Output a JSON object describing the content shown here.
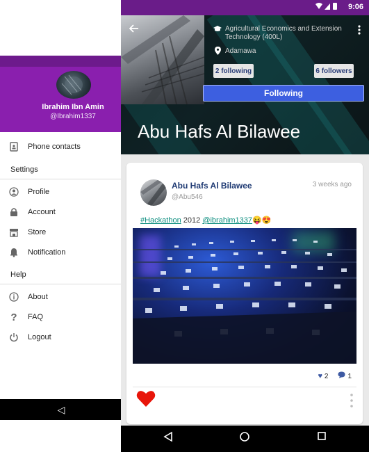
{
  "drawer": {
    "user_name": "Ibrahim Ibn Amin",
    "user_handle": "@Ibrahim1337",
    "items": [
      {
        "label": "Phone contacts",
        "icon": "contacts-icon"
      },
      {
        "label": "Profile",
        "icon": "person-icon"
      },
      {
        "label": "Account",
        "icon": "lock-icon"
      },
      {
        "label": "Store",
        "icon": "store-icon"
      },
      {
        "label": "Notification",
        "icon": "bell-icon"
      },
      {
        "label": "About",
        "icon": "info-icon"
      },
      {
        "label": "FAQ",
        "icon": "question-icon"
      },
      {
        "label": "Logout",
        "icon": "power-icon"
      }
    ],
    "sections": {
      "settings": "Settings",
      "help": "Help"
    },
    "nav_back": "◁"
  },
  "statusbar": {
    "time": "9:06",
    "icons": "▼◢▮"
  },
  "profile": {
    "school": "Agricultural Economics and Extension Technology (400L)",
    "location": "Adamawa",
    "following_count": "2 following",
    "followers_count": "6 followers",
    "follow_button": "Following",
    "name": "Abu Hafs Al Bilawee"
  },
  "post": {
    "author": "Abu Hafs Al Bilawee",
    "handle": "@Abu546",
    "time": "3 weeks ago",
    "hashtag": "#Hackathon",
    "year": " 2012 ",
    "mention": "@ibrahim1337",
    "emoji": "😝😍",
    "likes": "2",
    "comments": "1"
  },
  "navbar": {
    "back": "◁",
    "home": "○",
    "recents": "□"
  }
}
